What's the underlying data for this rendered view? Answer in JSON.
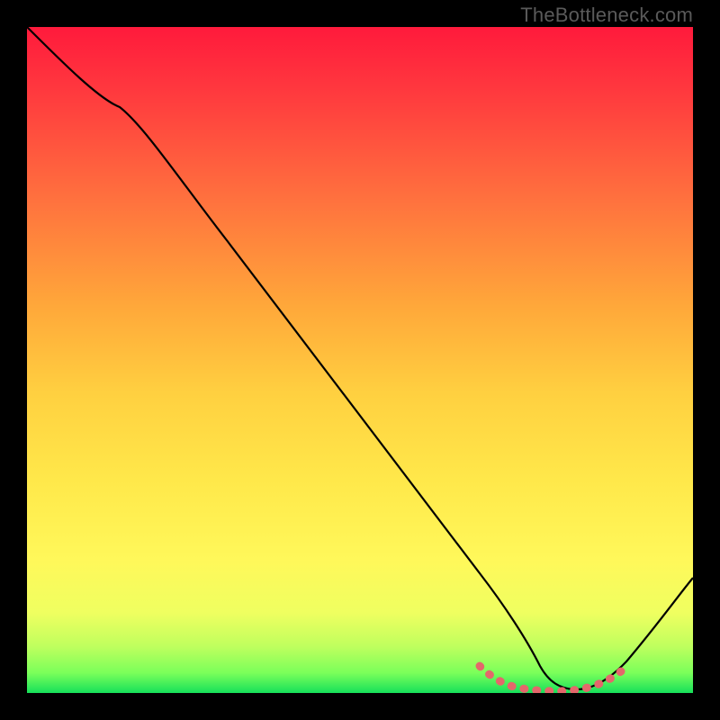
{
  "watermark": "TheBottleneck.com",
  "chart_data": {
    "type": "line",
    "title": "",
    "xlabel": "",
    "ylabel": "",
    "xlim": [
      0,
      100
    ],
    "ylim": [
      0,
      100
    ],
    "series": [
      {
        "name": "bottleneck-curve",
        "x": [
          0,
          8,
          14,
          20,
          30,
          40,
          50,
          60,
          68,
          73,
          77,
          80,
          83,
          86,
          90,
          94,
          98,
          100
        ],
        "y": [
          100,
          94,
          88,
          81,
          68,
          55,
          42,
          29,
          18,
          9,
          3,
          1,
          0.5,
          1,
          3,
          8,
          15,
          20
        ]
      }
    ],
    "highlight_region": {
      "name": "optimal-range",
      "x": [
        68,
        71,
        74,
        77,
        80,
        83,
        86,
        89
      ],
      "y": [
        3.5,
        2.5,
        2,
        1.7,
        1.5,
        1.7,
        2,
        3
      ]
    },
    "colors": {
      "curve": "#000000",
      "highlight": "#e4676b",
      "background_top": "#ff1a3c",
      "background_bottom": "#16e05a"
    }
  }
}
